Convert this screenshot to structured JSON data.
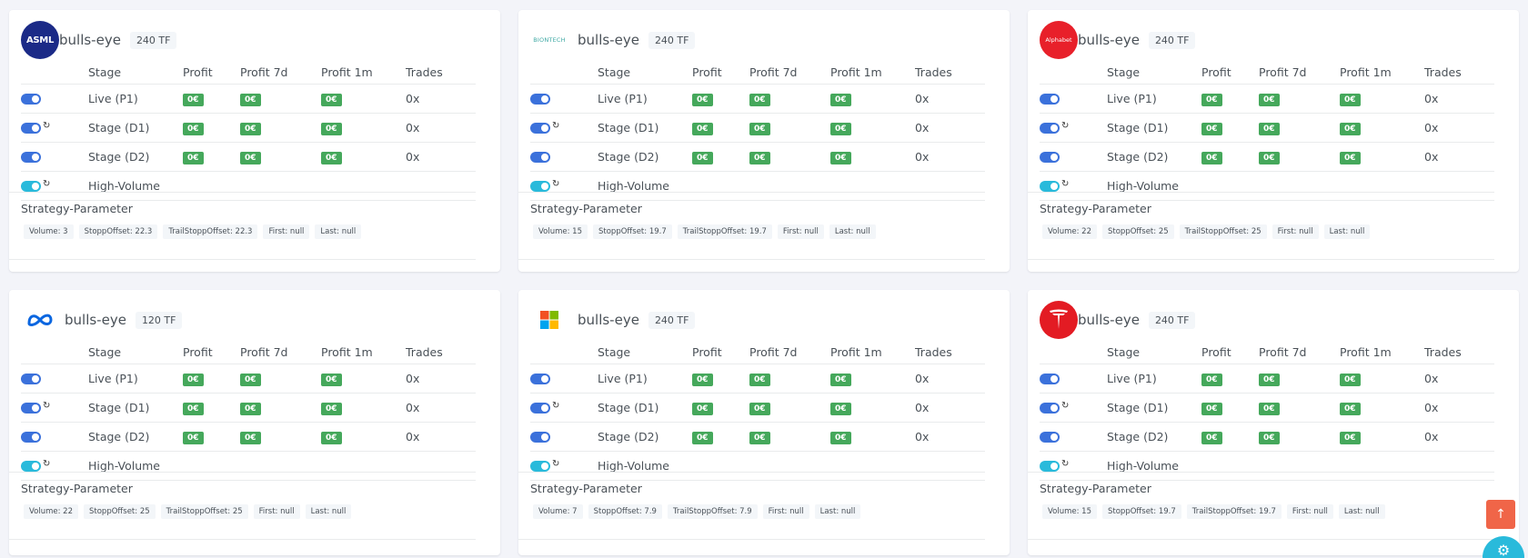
{
  "columns": [
    "Stage",
    "Profit",
    "Profit 7d",
    "Profit 1m",
    "Trades"
  ],
  "param_title": "Strategy-Parameter",
  "cards": [
    {
      "logo": "ASML",
      "title": "bulls-eye",
      "tf": "240 TF",
      "rows": [
        {
          "stage": "Live (P1)",
          "profit": "0€",
          "profit7": "0€",
          "profit1m": "0€",
          "trades": "0x"
        },
        {
          "stage": "Stage (D1)",
          "profit": "0€",
          "profit7": "0€",
          "profit1m": "0€",
          "trades": "0x"
        },
        {
          "stage": "Stage (D2)",
          "profit": "0€",
          "profit7": "0€",
          "profit1m": "0€",
          "trades": "0x"
        },
        {
          "stage": "High-Volume"
        }
      ],
      "params": [
        "Volume: 3",
        "StoppOffset: 22.3",
        "TrailStoppOffset: 22.3",
        "First: null",
        "Last: null"
      ]
    },
    {
      "logo": "BIONTECH",
      "title": "bulls-eye",
      "tf": "240 TF",
      "rows": [
        {
          "stage": "Live (P1)",
          "profit": "0€",
          "profit7": "0€",
          "profit1m": "0€",
          "trades": "0x"
        },
        {
          "stage": "Stage (D1)",
          "profit": "0€",
          "profit7": "0€",
          "profit1m": "0€",
          "trades": "0x"
        },
        {
          "stage": "Stage (D2)",
          "profit": "0€",
          "profit7": "0€",
          "profit1m": "0€",
          "trades": "0x"
        },
        {
          "stage": "High-Volume"
        }
      ],
      "params": [
        "Volume: 15",
        "StoppOffset: 19.7",
        "TrailStoppOffset: 19.7",
        "First: null",
        "Last: null"
      ]
    },
    {
      "logo": "Alphabet",
      "title": "bulls-eye",
      "tf": "240 TF",
      "rows": [
        {
          "stage": "Live (P1)",
          "profit": "0€",
          "profit7": "0€",
          "profit1m": "0€",
          "trades": "0x"
        },
        {
          "stage": "Stage (D1)",
          "profit": "0€",
          "profit7": "0€",
          "profit1m": "0€",
          "trades": "0x"
        },
        {
          "stage": "Stage (D2)",
          "profit": "0€",
          "profit7": "0€",
          "profit1m": "0€",
          "trades": "0x"
        },
        {
          "stage": "High-Volume"
        }
      ],
      "params": [
        "Volume: 22",
        "StoppOffset: 25",
        "TrailStoppOffset: 25",
        "First: null",
        "Last: null"
      ]
    },
    {
      "logo": "",
      "title": "bulls-eye",
      "tf": "120 TF",
      "rows": [
        {
          "stage": "Live (P1)",
          "profit": "0€",
          "profit7": "0€",
          "profit1m": "0€",
          "trades": "0x"
        },
        {
          "stage": "Stage (D1)",
          "profit": "0€",
          "profit7": "0€",
          "profit1m": "0€",
          "trades": "0x"
        },
        {
          "stage": "Stage (D2)",
          "profit": "0€",
          "profit7": "0€",
          "profit1m": "0€",
          "trades": "0x"
        },
        {
          "stage": "High-Volume"
        }
      ],
      "params": [
        "Volume: 22",
        "StoppOffset: 25",
        "TrailStoppOffset: 25",
        "First: null",
        "Last: null"
      ]
    },
    {
      "logo": "",
      "title": "bulls-eye",
      "tf": "240 TF",
      "rows": [
        {
          "stage": "Live (P1)",
          "profit": "0€",
          "profit7": "0€",
          "profit1m": "0€",
          "trades": "0x"
        },
        {
          "stage": "Stage (D1)",
          "profit": "0€",
          "profit7": "0€",
          "profit1m": "0€",
          "trades": "0x"
        },
        {
          "stage": "Stage (D2)",
          "profit": "0€",
          "profit7": "0€",
          "profit1m": "0€",
          "trades": "0x"
        },
        {
          "stage": "High-Volume"
        }
      ],
      "params": [
        "Volume: 7",
        "StoppOffset: 7.9",
        "TrailStoppOffset: 7.9",
        "First: null",
        "Last: null"
      ]
    },
    {
      "logo": "",
      "title": "bulls-eye",
      "tf": "240 TF",
      "rows": [
        {
          "stage": "Live (P1)",
          "profit": "0€",
          "profit7": "0€",
          "profit1m": "0€",
          "trades": "0x"
        },
        {
          "stage": "Stage (D1)",
          "profit": "0€",
          "profit7": "0€",
          "profit1m": "0€",
          "trades": "0x"
        },
        {
          "stage": "Stage (D2)",
          "profit": "0€",
          "profit7": "0€",
          "profit1m": "0€",
          "trades": "0x"
        },
        {
          "stage": "High-Volume"
        }
      ],
      "params": [
        "Volume: 15",
        "StoppOffset: 19.7",
        "TrailStoppOffset: 19.7",
        "First: null",
        "Last: null"
      ]
    }
  ],
  "icons": {
    "scroll_top": "arrow-up-icon",
    "settings": "gear-icon",
    "sync": "sync-icon"
  },
  "colors": {
    "toggle_on": "#3b71db",
    "toggle_hv": "#29badb",
    "profit_badge": "#45a85b",
    "scroll_top": "#f06548",
    "fab": "#29badb"
  }
}
